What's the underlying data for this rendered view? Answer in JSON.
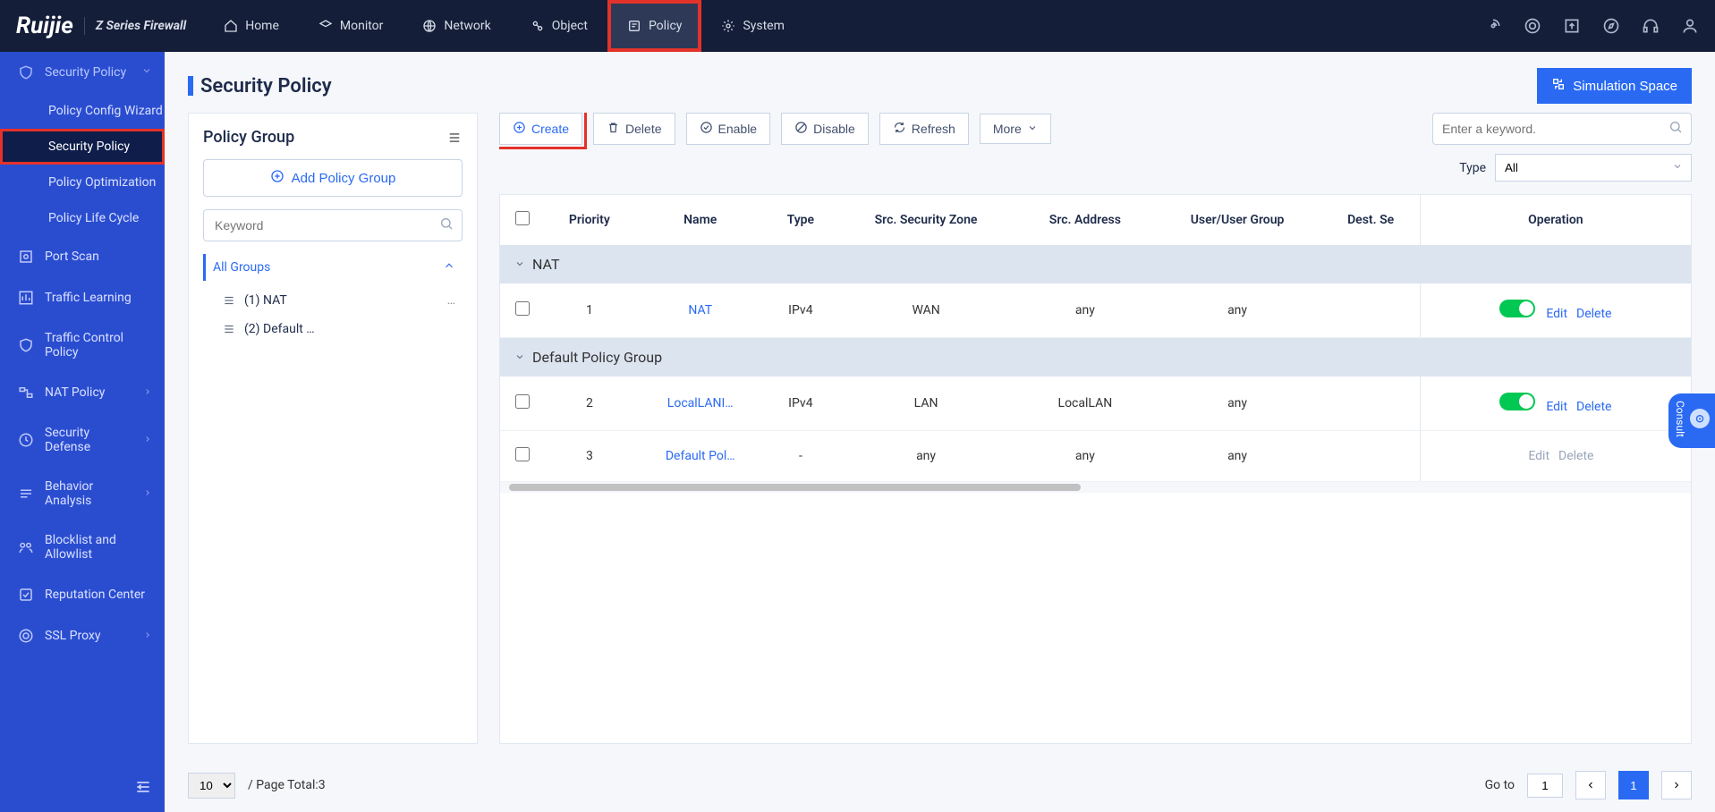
{
  "brand": {
    "name": "Ruijie",
    "sub": "Z Series Firewall"
  },
  "topnav": {
    "home": "Home",
    "monitor": "Monitor",
    "network": "Network",
    "object": "Object",
    "policy": "Policy",
    "system": "System"
  },
  "sidebar": {
    "header": "Security Policy",
    "items": {
      "config_wizard": "Policy Config Wizard",
      "security_policy": "Security Policy",
      "optimization": "Policy Optimization",
      "life_cycle": "Policy Life Cycle"
    },
    "port_scan": "Port Scan",
    "traffic_learning": "Traffic Learning",
    "traffic_control": "Traffic Control Policy",
    "nat_policy": "NAT Policy",
    "security_defense": "Security Defense",
    "behavior_analysis": "Behavior Analysis",
    "blocklist": "Blocklist and Allowlist",
    "reputation": "Reputation Center",
    "ssl_proxy": "SSL Proxy"
  },
  "page": {
    "title": "Security Policy",
    "simulation": "Simulation Space"
  },
  "group_panel": {
    "title": "Policy Group",
    "add_button": "Add Policy Group",
    "search_placeholder": "Keyword",
    "root": "All Groups",
    "items": [
      {
        "label": "(1) NAT",
        "more": "…"
      },
      {
        "label": "(2) Default …"
      }
    ]
  },
  "toolbar": {
    "create": "Create",
    "delete": "Delete",
    "enable": "Enable",
    "disable": "Disable",
    "refresh": "Refresh",
    "more": "More",
    "search_placeholder": "Enter a keyword.",
    "type_label": "Type",
    "type_value": "All"
  },
  "table": {
    "headers": {
      "priority": "Priority",
      "name": "Name",
      "type": "Type",
      "src_zone": "Src. Security Zone",
      "src_addr": "Src. Address",
      "user_group": "User/User Group",
      "dest_se": "Dest. Se",
      "operation": "Operation"
    },
    "groups": [
      {
        "name": "NAT",
        "rows": [
          {
            "priority": "1",
            "name": "NAT",
            "type": "IPv4",
            "src_zone": "WAN",
            "src_addr": "any",
            "user_group": "any",
            "enabled": true,
            "editable": true
          }
        ]
      },
      {
        "name": "Default Policy Group",
        "rows": [
          {
            "priority": "2",
            "name": "LocalLANI…",
            "type": "IPv4",
            "src_zone": "LAN",
            "src_addr": "LocalLAN",
            "user_group": "any",
            "enabled": true,
            "editable": true
          },
          {
            "priority": "3",
            "name": "Default Pol…",
            "type": "-",
            "src_zone": "any",
            "src_addr": "any",
            "user_group": "any",
            "cb_gray": true,
            "enabled": false,
            "editable": false
          }
        ]
      }
    ],
    "op_edit": "Edit",
    "op_delete": "Delete"
  },
  "pagination": {
    "page_size": "10",
    "total_label": "/ Page Total:3",
    "goto_label": "Go to",
    "goto_value": "1",
    "current": "1"
  },
  "consult": "Consult"
}
